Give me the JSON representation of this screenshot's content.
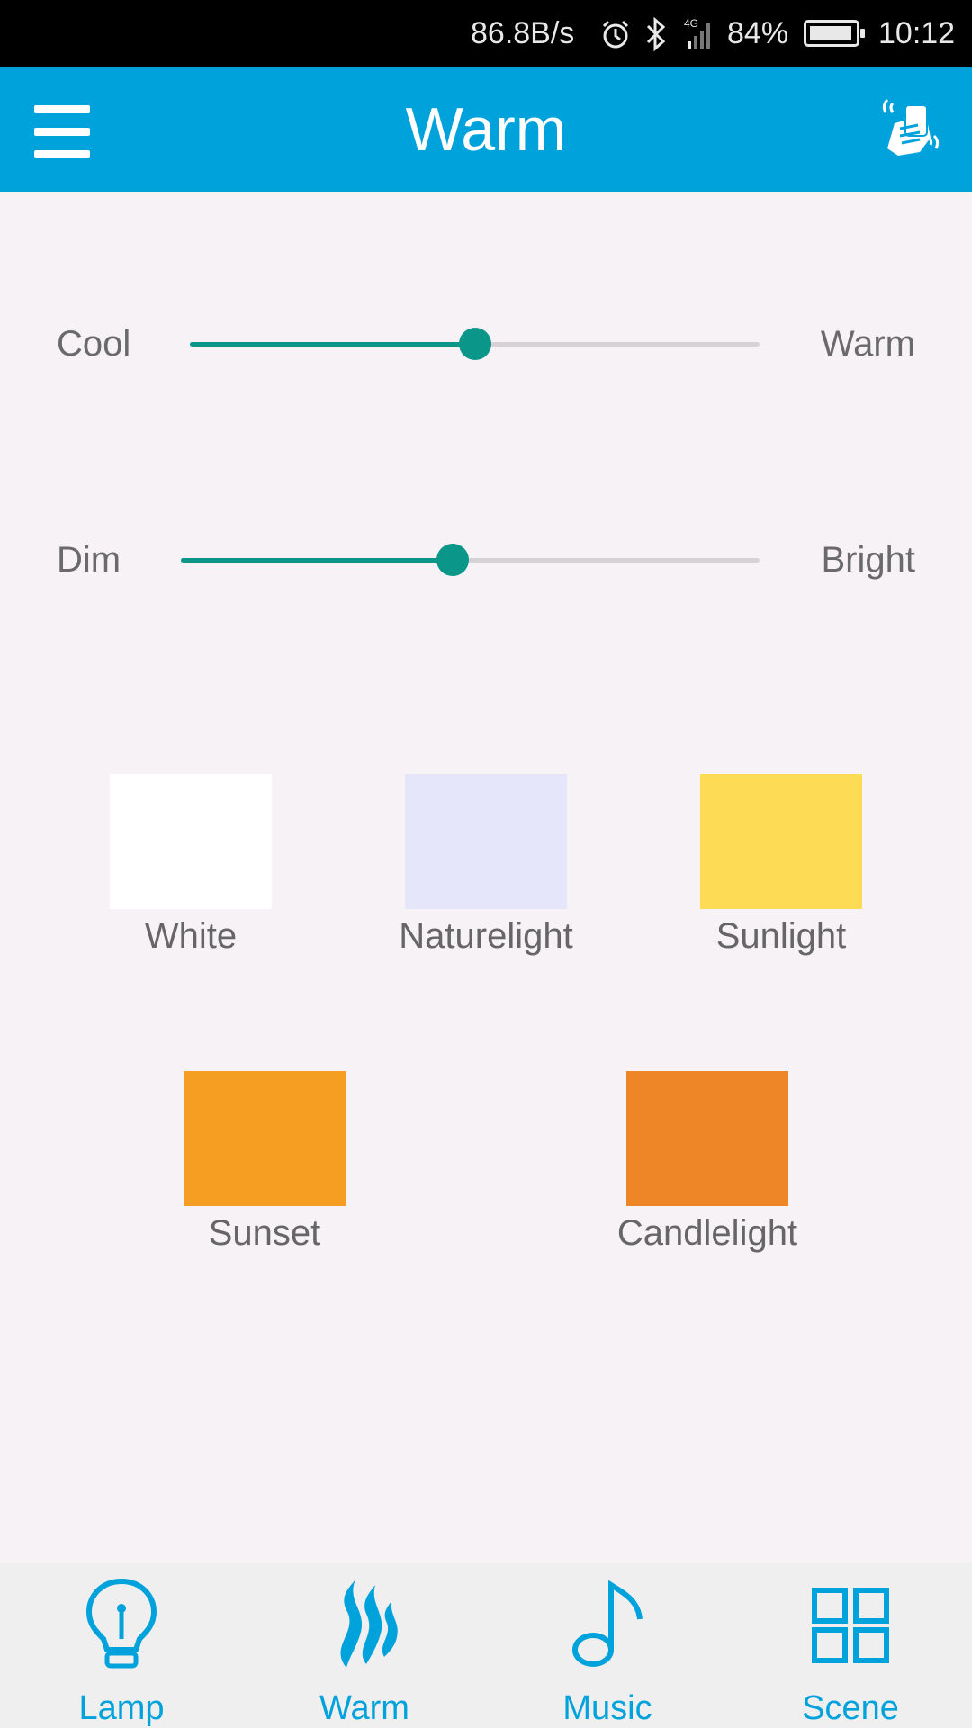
{
  "status_bar": {
    "net_speed": "86.8B/s",
    "network": "4G",
    "battery": "84%",
    "time": "10:12"
  },
  "app_bar": {
    "title": "Warm"
  },
  "sliders": {
    "temperature": {
      "left_label": "Cool",
      "right_label": "Warm",
      "value_fraction": 0.5
    },
    "brightness": {
      "left_label": "Dim",
      "right_label": "Bright",
      "value_fraction": 0.47
    }
  },
  "presets": [
    {
      "label": "White",
      "color": "#ffffff"
    },
    {
      "label": "Naturelight",
      "color": "#e6e6fa"
    },
    {
      "label": "Sunlight",
      "color": "#fedb55"
    },
    {
      "label": "Sunset",
      "color": "#f59e22"
    },
    {
      "label": "Candlelight",
      "color": "#ee8526"
    }
  ],
  "bottom_nav": {
    "items": [
      {
        "label": "Lamp",
        "icon": "lightbulb-icon"
      },
      {
        "label": "Warm",
        "icon": "flame-icon"
      },
      {
        "label": "Music",
        "icon": "music-note-icon"
      },
      {
        "label": "Scene",
        "icon": "grid-icon"
      }
    ]
  },
  "colors": {
    "accent": "#00a2dc",
    "slider": "#0a9688",
    "background": "#f7f2f6"
  }
}
